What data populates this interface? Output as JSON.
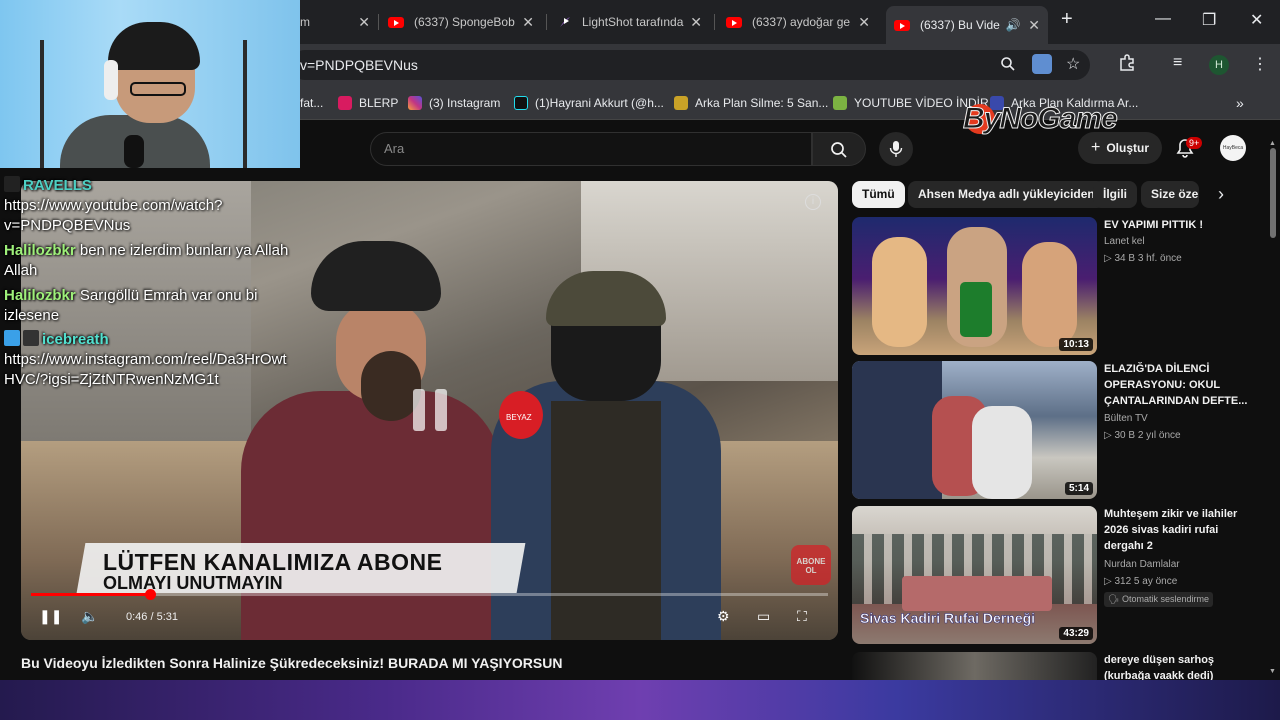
{
  "browser": {
    "tabs": [
      {
        "label": "m"
      },
      {
        "label": "(6337) SpongeBob"
      },
      {
        "label": "LightShot tarafında"
      },
      {
        "label": "(6337) aydoğar ge"
      },
      {
        "label": "(6337) Bu Vide"
      }
    ],
    "url": "v=PNDPQBEVNus",
    "profile_initial": "H",
    "bookmarks": [
      {
        "label": "fat...",
        "color": "#e8a200"
      },
      {
        "label": "BLERP",
        "color": "#d81b60"
      },
      {
        "label": "(3) Instagram",
        "color": "#c13584"
      },
      {
        "label": "(1)Hayrani Akkurt (@h...",
        "color": "#111111"
      },
      {
        "label": "Arka Plan Silme: 5 San...",
        "color": "#c9a227"
      },
      {
        "label": "YOUTUBE VİDEO İNDİR",
        "color": "#7cb342"
      },
      {
        "label": "Arka Plan Kaldırma Ar...",
        "color": "#3949ab"
      }
    ]
  },
  "youtube": {
    "search_placeholder": "Ara",
    "create_label": "Oluştur",
    "notif_count": "9+",
    "avatar_text": "HayBeca",
    "video": {
      "banner_line1": "LÜTFEN KANALIMIZA ABONE",
      "banner_line2": "OLMAYI UNUTMAYIN",
      "abone_badge": "ABONE OL",
      "station": "BEYAZ",
      "time": "0:46 / 5:31",
      "progress": 0.149,
      "title": "Bu Videoyu İzledikten Sonra Halinize Şükredeceksiniz! BURADA MI YAŞIYORSUN"
    },
    "chips": [
      "Tümü",
      "Ahsen Medya adlı yükleyiciden",
      "İlgili",
      "Size özel"
    ],
    "recommendations": [
      {
        "title": "EV YAPIMI PITTIK !",
        "channel": "Lanet kel",
        "meta": "▷ 34 B  3 hf. önce",
        "duration": "10:13"
      },
      {
        "title": "ELAZIĞ'DA DİLENCİ OPERASYONU: OKUL ÇANTALARINDAN DEFTE...",
        "channel": "Bülten TV",
        "meta": "▷ 30 B  2 yıl önce",
        "duration": "5:14"
      },
      {
        "title": "Muhteşem zikir ve ilahiler 2026 sivas kadiri rufai dergahı 2",
        "channel": "Nurdan Damlalar",
        "meta": "▷ 312  5 ay önce",
        "duration": "43:29",
        "badge": "Otomatik seslendirme",
        "thumb_text": "Sivas Kadiri Rufai Derneği"
      },
      {
        "title": "dereye düşen sarhoş (kurbağa vaakk dedi)",
        "channel": "",
        "meta": "",
        "duration": ""
      }
    ]
  },
  "stream_overlay": {
    "watermark": "ByNoGame",
    "chat": [
      {
        "name": "RAVELLS",
        "text": "",
        "name_color": "#4dd0c4"
      },
      {
        "name": "",
        "text": "https://www.youtube.com/watch?v=PNDPQBEVNus"
      },
      {
        "name": "Halilozbkr",
        "text": "ben ne izlerdim bunları ya Allah Allah",
        "name_color": "#9ef07a"
      },
      {
        "name": "Halilozbkr",
        "text": "Sarıgöllü Emrah var onu bi izlesene",
        "name_color": "#9ef07a"
      },
      {
        "name": "icebreath",
        "text": "",
        "name_color": "#52e1d0"
      },
      {
        "name": "",
        "text": "https://www.instagram.com/reel/Da3HrOwtHVC/?igsi=ZjZtNTRwenNzMG1t"
      }
    ]
  }
}
